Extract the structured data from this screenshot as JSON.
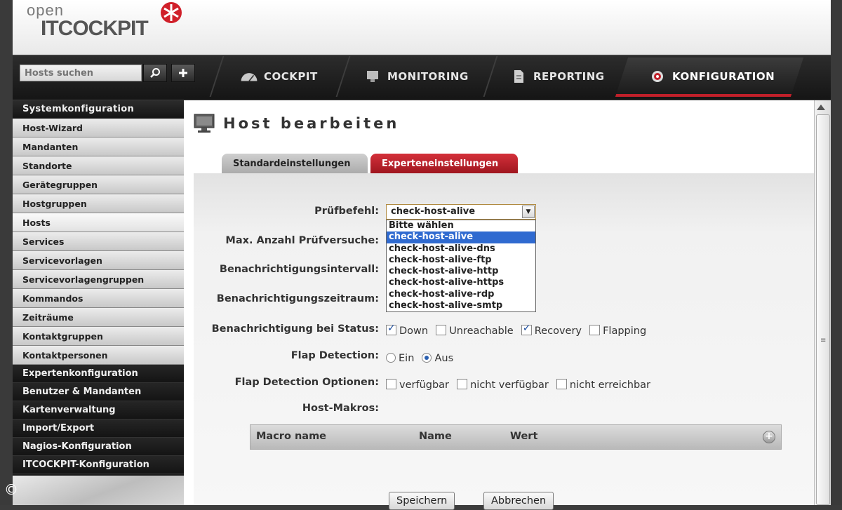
{
  "logo": {
    "top_text": "open",
    "brand_text": "ITCOCKPIT"
  },
  "search": {
    "placeholder": "Hosts suchen"
  },
  "nav": {
    "tabs": [
      {
        "label": "COCKPIT",
        "icon": "gauge-icon"
      },
      {
        "label": "MONITORING",
        "icon": "monitor-icon"
      },
      {
        "label": "REPORTING",
        "icon": "report-icon"
      },
      {
        "label": "KONFIGURATION",
        "icon": "target-icon",
        "active": true
      }
    ],
    "accent_color": "#c0202a"
  },
  "sidebar": {
    "section_title": "Systemkonfiguration",
    "items": [
      "Host-Wizard",
      "Mandanten",
      "Standorte",
      "Gerätegruppen",
      "Hostgruppen",
      "Hosts",
      "Services",
      "Servicevorlagen",
      "Servicevorlagengruppen",
      "Kommandos",
      "Zeiträume",
      "Kontaktgruppen",
      "Kontaktpersonen"
    ],
    "active_item": "Hosts",
    "sections": [
      "Expertenkonfiguration",
      "Benutzer & Mandanten",
      "Kartenverwaltung",
      "Import/Export",
      "Nagios-Konfiguration",
      "ITCOCKPIT-Konfiguration"
    ]
  },
  "page": {
    "title": "Host bearbeiten",
    "tabs": {
      "standard": "Standardeinstellungen",
      "expert": "Experteneinstellungen"
    }
  },
  "form": {
    "check_command_label": "Prüfbefehl:",
    "check_command_value": "check-host-alive",
    "check_command_options": [
      "Bitte wählen",
      "check-host-alive",
      "check-host-alive-dns",
      "check-host-alive-ftp",
      "check-host-alive-http",
      "check-host-alive-https",
      "check-host-alive-rdp",
      "check-host-alive-smtp"
    ],
    "max_attempts_label": "Max. Anzahl Prüfversuche:",
    "notif_interval_label": "Benachrichtigungsintervall:",
    "notif_period_label": "Benachrichtigungszeitraum:",
    "notif_status_label": "Benachrichtigung bei Status:",
    "notif_status_options": [
      {
        "label": "Down",
        "checked": true
      },
      {
        "label": "Unreachable",
        "checked": false
      },
      {
        "label": "Recovery",
        "checked": true
      },
      {
        "label": "Flapping",
        "checked": false
      }
    ],
    "flap_detection_label": "Flap Detection:",
    "flap_detection_options": [
      {
        "label": "Ein",
        "selected": false
      },
      {
        "label": "Aus",
        "selected": true
      }
    ],
    "flap_options_label": "Flap Detection Optionen:",
    "flap_options": [
      {
        "label": "verfügbar",
        "checked": false
      },
      {
        "label": "nicht verfügbar",
        "checked": false
      },
      {
        "label": "nicht erreichbar",
        "checked": false
      }
    ],
    "host_macros_label": "Host-Makros:",
    "macro_table_headers": {
      "macro_name": "Macro name",
      "name": "Name",
      "value": "Wert"
    }
  },
  "buttons": {
    "save": "Speichern",
    "cancel": "Abbrechen"
  },
  "copyright": "©"
}
